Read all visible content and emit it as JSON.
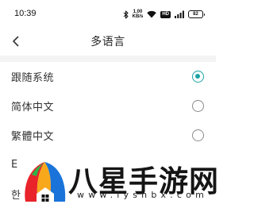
{
  "status_bar": {
    "time": "10:39",
    "net_speed_value": "1.00",
    "net_speed_unit": "KB/s",
    "signal_badge": "HD",
    "battery": "82"
  },
  "header": {
    "title": "多语言",
    "back_icon": "chevron-left-icon"
  },
  "languages": [
    {
      "label": "跟随系统",
      "selected": true
    },
    {
      "label": "简体中文",
      "selected": false
    },
    {
      "label": "繁體中文",
      "selected": false
    },
    {
      "label": "E",
      "selected": false
    },
    {
      "label": "한",
      "selected": false
    }
  ],
  "watermark": {
    "title": "八星手游网",
    "url": "www.lyshbx.com"
  },
  "colors": {
    "accent": "#1aa3a3",
    "separator": "#f4f4f4"
  }
}
